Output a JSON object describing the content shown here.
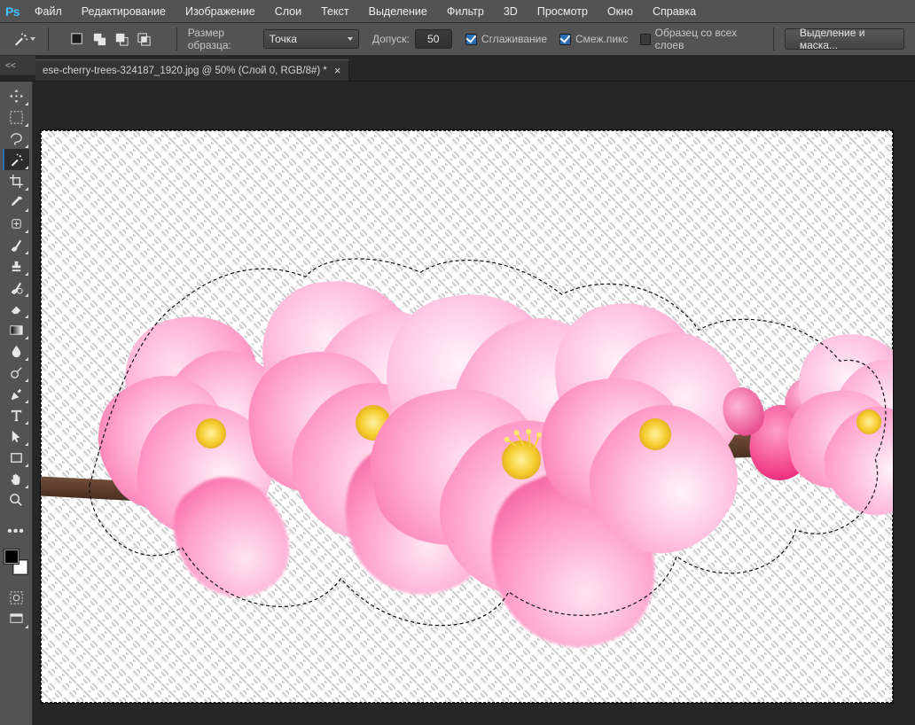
{
  "app": {
    "logo": "Ps"
  },
  "menu": [
    "Файл",
    "Редактирование",
    "Изображение",
    "Слои",
    "Текст",
    "Выделение",
    "Фильтр",
    "3D",
    "Просмотр",
    "Окно",
    "Справка"
  ],
  "options": {
    "sample_size_label": "Размер образца:",
    "sample_size_value": "Точка",
    "tolerance_label": "Допуск:",
    "tolerance_value": "50",
    "antialias_label": "Сглаживание",
    "antialias_checked": true,
    "contiguous_label": "Смеж.пикс",
    "contiguous_checked": true,
    "all_layers_label": "Образец со всех слоев",
    "all_layers_checked": false,
    "select_mask_btn": "Выделение и маска..."
  },
  "tab": {
    "title": "ese-cherry-trees-324187_1920.jpg @ 50% (Слой 0, RGB/8#) *"
  },
  "narrow_panel_caret": "<<",
  "tools": [
    {
      "name": "move",
      "tri": true
    },
    {
      "name": "marquee",
      "tri": true
    },
    {
      "name": "lasso",
      "tri": true
    },
    {
      "name": "magic-wand",
      "tri": true,
      "selected": true
    },
    {
      "name": "crop",
      "tri": true
    },
    {
      "name": "eyedropper",
      "tri": true
    },
    {
      "name": "healing-brush",
      "tri": true
    },
    {
      "name": "brush",
      "tri": true
    },
    {
      "name": "stamp",
      "tri": true
    },
    {
      "name": "history-brush",
      "tri": true
    },
    {
      "name": "eraser",
      "tri": true
    },
    {
      "name": "gradient",
      "tri": true
    },
    {
      "name": "blur",
      "tri": true
    },
    {
      "name": "dodge",
      "tri": true
    },
    {
      "name": "pen",
      "tri": true
    },
    {
      "name": "type",
      "tri": true
    },
    {
      "name": "path-select",
      "tri": true
    },
    {
      "name": "rectangle",
      "tri": true
    },
    {
      "name": "hand",
      "tri": true
    },
    {
      "name": "zoom",
      "tri": false
    },
    {
      "name": "more",
      "tri": false
    }
  ]
}
